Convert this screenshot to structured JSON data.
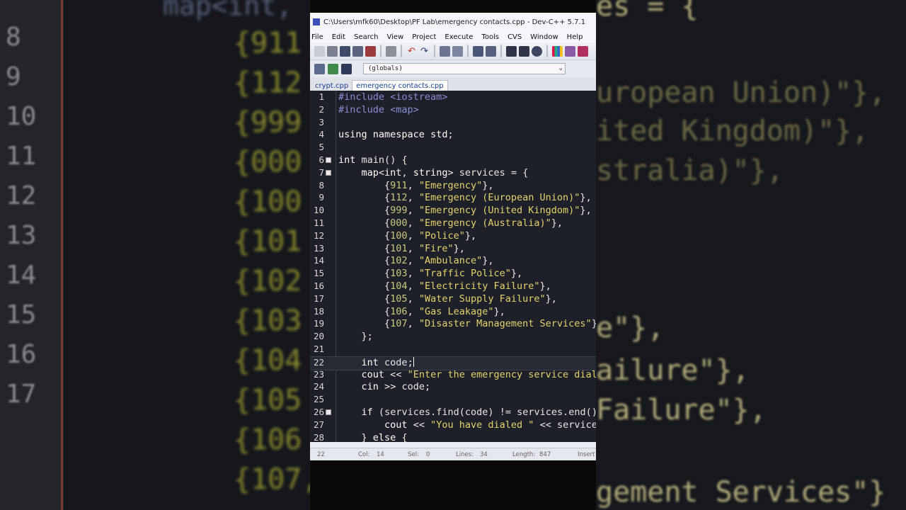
{
  "window": {
    "title": "C:\\Users\\mfk60\\Desktop\\PF Lab\\emergency contacts.cpp - Dev-C++ 5.7.1"
  },
  "menu": [
    "File",
    "Edit",
    "Search",
    "View",
    "Project",
    "Execute",
    "Tools",
    "CVS",
    "Window",
    "Help"
  ],
  "toolbar": {
    "scope": "(globals)"
  },
  "tabs": [
    {
      "label": "crypt.cpp",
      "active": false
    },
    {
      "label": "emergency contacts.cpp",
      "active": true
    }
  ],
  "editor": {
    "current_line": 22,
    "lines": [
      {
        "n": "1",
        "text": "#include <iostream>"
      },
      {
        "n": "2",
        "text": "#include <map>"
      },
      {
        "n": "3",
        "text": ""
      },
      {
        "n": "4",
        "text": "using namespace std;"
      },
      {
        "n": "5",
        "text": ""
      },
      {
        "n": "6",
        "text": "int main() {"
      },
      {
        "n": "7",
        "text": "    map<int, string> services = {"
      },
      {
        "n": "8",
        "text": "        {911, \"Emergency\"},"
      },
      {
        "n": "9",
        "text": "        {112, \"Emergency (European Union)\"},"
      },
      {
        "n": "10",
        "text": "        {999, \"Emergency (United Kingdom)\"},"
      },
      {
        "n": "11",
        "text": "        {000, \"Emergency (Australia)\"},"
      },
      {
        "n": "12",
        "text": "        {100, \"Police\"},"
      },
      {
        "n": "13",
        "text": "        {101, \"Fire\"},"
      },
      {
        "n": "14",
        "text": "        {102, \"Ambulance\"},"
      },
      {
        "n": "15",
        "text": "        {103, \"Traffic Police\"},"
      },
      {
        "n": "16",
        "text": "        {104, \"Electricity Failure\"},"
      },
      {
        "n": "17",
        "text": "        {105, \"Water Supply Failure\"},"
      },
      {
        "n": "18",
        "text": "        {106, \"Gas Leakage\"},"
      },
      {
        "n": "19",
        "text": "        {107, \"Disaster Management Services\"}"
      },
      {
        "n": "20",
        "text": "    };"
      },
      {
        "n": "21",
        "text": ""
      },
      {
        "n": "22",
        "text": "    int code;"
      },
      {
        "n": "23",
        "text": "    cout << \"Enter the emergency service dial"
      },
      {
        "n": "24",
        "text": "    cin >> code;"
      },
      {
        "n": "25",
        "text": ""
      },
      {
        "n": "26",
        "text": "    if (services.find(code) != services.end())"
      },
      {
        "n": "27",
        "text": "        cout << \"You have dialed \" << services"
      },
      {
        "n": "28",
        "text": "    } else {"
      }
    ]
  },
  "status": {
    "line": "22",
    "col_label": "Col:",
    "col": "14",
    "sel_label": "Sel:",
    "sel": "0",
    "lines_label": "Lines:",
    "lines": "34",
    "length_label": "Length:",
    "length": "847",
    "mode": "Insert"
  },
  "background": {
    "left_numbers": [
      "8",
      "9",
      "10",
      "11",
      "12",
      "13",
      "14",
      "15",
      "16",
      "17"
    ],
    "left_code": [
      "{911",
      "{112",
      "{999",
      "{000",
      "{100",
      "{101",
      "{102",
      "{103",
      "{104",
      "{105",
      "{106",
      "{107,"
    ],
    "left_top": "map<int,",
    "right_top": "es = {",
    "right_code": [
      "uropean Union)\"},",
      "ited Kingdom)\"},",
      "stralia)\"},",
      "e\"},",
      "ailure\"},",
      "Failure\"},",
      "gement Services\"}"
    ]
  },
  "colors": {
    "editor_bg": "#1d2029",
    "string": "#e8d26a",
    "number": "#c9c979",
    "preprocessor": "#8a8dd8"
  }
}
